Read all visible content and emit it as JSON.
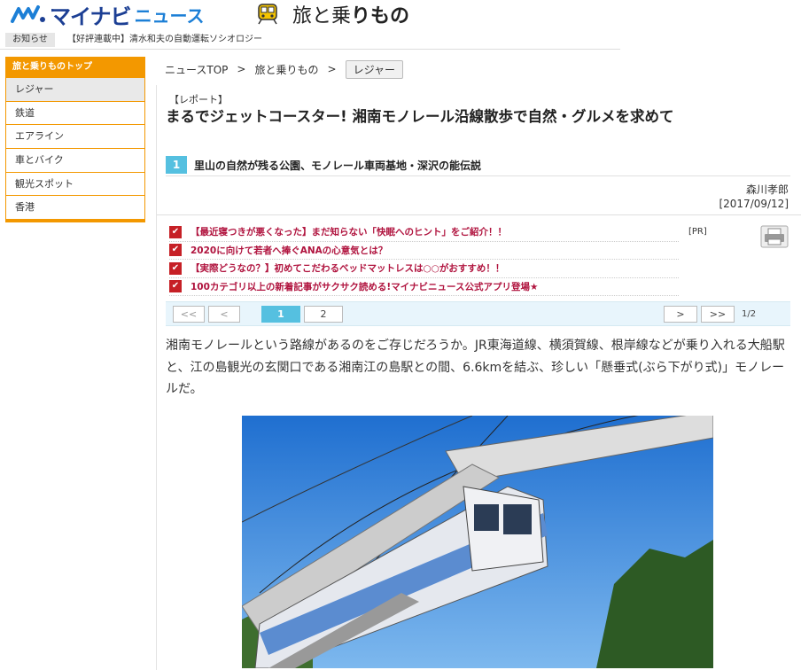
{
  "header": {
    "logo_text": "マイナビ",
    "logo_sub": "ニュース",
    "section_plain": "旅と乗",
    "section_bold": "りもの"
  },
  "news_bar": {
    "label": "お知らせ",
    "ticker": "【好評連載中】清水和夫の自動運転ソシオロジー"
  },
  "sidebar": {
    "top": "旅と乗りものトップ",
    "items": [
      {
        "label": "レジャー"
      },
      {
        "label": "鉄道"
      },
      {
        "label": "エアライン"
      },
      {
        "label": "車とバイク"
      },
      {
        "label": "観光スポット"
      },
      {
        "label": "香港"
      }
    ]
  },
  "breadcrumb": {
    "items": [
      "ニュースTOP",
      "旅と乗りもの"
    ],
    "current": "レジャー",
    "sep": ">"
  },
  "article": {
    "tag": "【レポート】",
    "headline": "まるでジェットコースター! 湘南モノレール沿線散歩で自然・グルメを求めて",
    "page_number": "1",
    "page_title": "里山の自然が残る公園、モノレール車両基地・深沢の能伝説",
    "author": "森川孝郎",
    "date": "[2017/09/12]",
    "pr_label": "[PR]",
    "pr_items": [
      "【最近寝つきが悪くなった】まだ知らない「快眠へのヒント」をご紹介！！",
      "2020に向けて若者へ捧ぐANAの心意気とは？",
      "【実際どうなの？】初めてこだわるベッドマットレスは○○がおすすめ！！",
      "100カテゴリ以上の新着記事がサクサク読める!マイナビニュース公式アプリ登場★"
    ],
    "pager": {
      "first": "<<",
      "prev": "<",
      "pages": [
        "1",
        "2"
      ],
      "next": ">",
      "last": ">>",
      "count": "1/2"
    },
    "body": "湘南モノレールという路線があるのをご存じだろうか。JR東海道線、横須賀線、根岸線などが乗り入れる大船駅と、江の島観光の玄関口である湘南江の島駅との間、6.6kmを結ぶ、珍しい「懸垂式(ぶら下がり式)」モノレールだ。"
  },
  "colors": {
    "brand_blue": "#1c3f94",
    "accent_orange": "#f39800",
    "pager_blue": "#55c0e0",
    "pr_red": "#b0133e"
  }
}
